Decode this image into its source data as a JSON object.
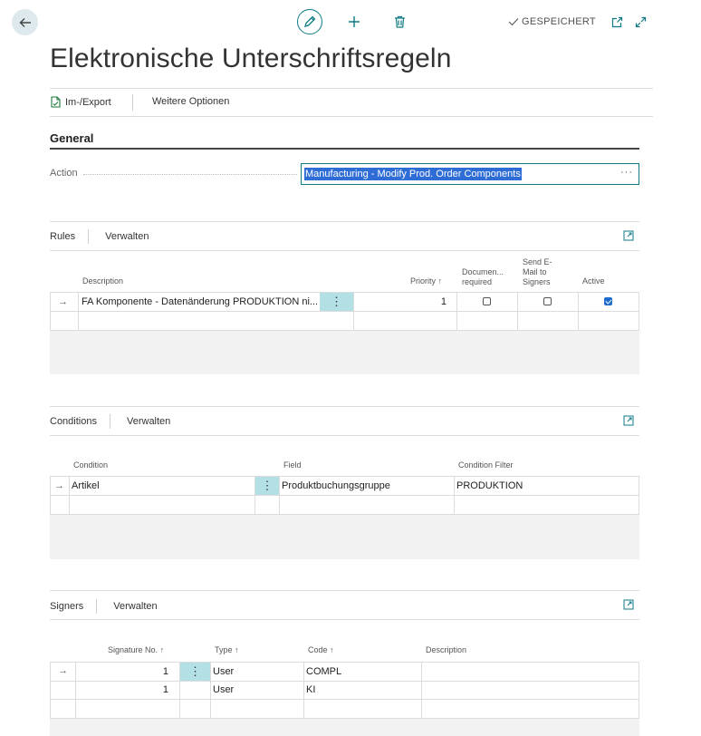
{
  "toolbar": {
    "saved_label": "GESPEICHERT"
  },
  "page": {
    "title": "Elektronische Unterschriftsregeln"
  },
  "actionbar": {
    "import_export": "Im-/Export",
    "more_options": "Weitere Optionen"
  },
  "general": {
    "section_title": "General",
    "action_label": "Action",
    "action_value": "Manufacturing - Modify Prod. Order Components",
    "more": "···"
  },
  "rules": {
    "title": "Rules",
    "manage": "Verwalten",
    "columns": {
      "description": "Description",
      "priority": "Priority",
      "document_required_1": "Documen...",
      "document_required_2": "required",
      "send_email_1": "Send E-",
      "send_email_2": "Mail to",
      "send_email_3": "Signers",
      "active": "Active"
    },
    "rows": [
      {
        "description": "FA Komponente - Datenänderung PRODUKTION ni...",
        "priority": "1",
        "document_required": false,
        "send_email": false,
        "active": true
      }
    ]
  },
  "conditions": {
    "title": "Conditions",
    "manage": "Verwalten",
    "columns": {
      "condition": "Condition",
      "field": "Field",
      "condition_filter": "Condition Filter"
    },
    "rows": [
      {
        "condition": "Artikel",
        "field": "Produktbuchungsgruppe",
        "filter": "PRODUKTION"
      }
    ]
  },
  "signers": {
    "title": "Signers",
    "manage": "Verwalten",
    "columns": {
      "signature_no": "Signature No.",
      "type": "Type",
      "code": "Code",
      "description": "Description"
    },
    "rows": [
      {
        "signature_no": "1",
        "type": "User",
        "code": "COMPL"
      },
      {
        "signature_no": "1",
        "type": "User",
        "code": "KI"
      }
    ]
  },
  "colors": {
    "accent": "#0f7a84",
    "selection": "#2f6dd6",
    "row_highlight": "#b3e0e5"
  }
}
